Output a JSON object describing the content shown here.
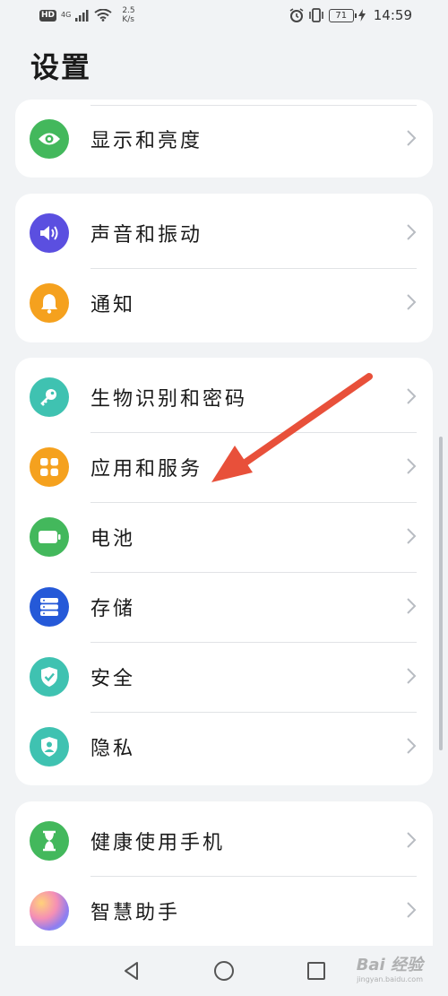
{
  "status_bar": {
    "hd": "HD",
    "network": "4G",
    "speed_value": "2.5",
    "speed_unit": "K/s",
    "battery": "71",
    "time": "14:59"
  },
  "page": {
    "title": "设置"
  },
  "groups": [
    {
      "items": [
        {
          "label": "显示和亮度",
          "icon": "eye-icon",
          "color": "#43b85c"
        }
      ]
    },
    {
      "items": [
        {
          "label": "声音和振动",
          "icon": "speaker-icon",
          "color": "#5b4fe0"
        },
        {
          "label": "通知",
          "icon": "bell-icon",
          "color": "#f5a11e"
        }
      ]
    },
    {
      "items": [
        {
          "label": "生物识别和密码",
          "icon": "key-icon",
          "color": "#3fc2b1"
        },
        {
          "label": "应用和服务",
          "icon": "apps-grid-icon",
          "color": "#f5a11e"
        },
        {
          "label": "电池",
          "icon": "battery-icon",
          "color": "#43b85c"
        },
        {
          "label": "存储",
          "icon": "storage-icon",
          "color": "#2559d8"
        },
        {
          "label": "安全",
          "icon": "shield-check-icon",
          "color": "#3fc2b1"
        },
        {
          "label": "隐私",
          "icon": "privacy-shield-icon",
          "color": "#3fc2b1"
        }
      ]
    },
    {
      "items": [
        {
          "label": "健康使用手机",
          "icon": "hourglass-icon",
          "color": "#43b85c"
        },
        {
          "label": "智慧助手",
          "icon": "assistant-orb-icon",
          "color": "#c98ef0"
        }
      ]
    }
  ],
  "annotation": {
    "arrow_color": "#e8503a"
  },
  "watermark": {
    "brand": "Bai 经验",
    "url": "jingyan.baidu.com"
  }
}
